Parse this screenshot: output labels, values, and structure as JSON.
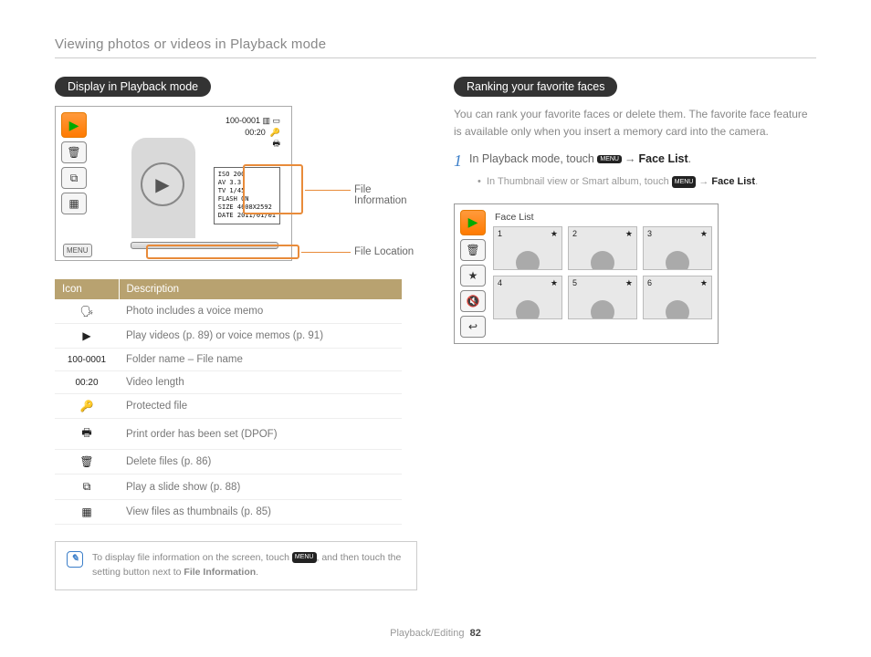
{
  "page_title": "Viewing photos or videos in Playback mode",
  "footer_section": "Playback/Editing",
  "footer_page": "82",
  "left": {
    "pill": "Display in Playback mode",
    "screen": {
      "file_id": "100-0001",
      "time": "00:20",
      "menu": "MENU",
      "info_lines": [
        "ISO 200",
        "AV 3.3",
        "TV 1/45",
        "FLASH ON",
        "SIZE 4608X2592",
        "DATE 2011/01/01"
      ]
    },
    "callouts": {
      "info": "File Information",
      "loc": "File Location"
    },
    "table_headers": {
      "icon": "Icon",
      "desc": "Description"
    },
    "rows": [
      {
        "icon": "🗣",
        "desc": "Photo includes a voice memo"
      },
      {
        "icon": "▶",
        "desc": "Play videos (p. 89) or voice memos (p. 91)"
      },
      {
        "icon": "100-0001",
        "desc": "Folder name – File name"
      },
      {
        "icon": "00:20",
        "desc": "Video length"
      },
      {
        "icon": "🔑",
        "desc": "Protected file"
      },
      {
        "icon": "🖶",
        "desc": "Print order has been set (DPOF)"
      },
      {
        "icon": "🗑",
        "desc": "Delete files (p. 86)"
      },
      {
        "icon": "⧉",
        "desc": "Play a slide show (p. 88)"
      },
      {
        "icon": "▦",
        "desc": "View files as thumbnails (p. 85)"
      }
    ],
    "note_pre": "To display file information on the screen, touch ",
    "note_menu": "MENU",
    "note_mid": ", and then touch the setting button next to ",
    "note_bold": "File Information",
    "note_post": "."
  },
  "right": {
    "pill": "Ranking your favorite faces",
    "intro": "You can rank your favorite faces or delete them. The favorite face feature is available only when you insert a memory card into the camera.",
    "step_num": "1",
    "step_pre": "In Playback mode, touch ",
    "step_menu": "MENU",
    "step_arrow": "→",
    "step_bold": "Face List",
    "step_post": ".",
    "sub_pre": "In Thumbnail view or Smart album, touch ",
    "sub_menu": "MENU",
    "sub_arrow": "→",
    "sub_bold": "Face List",
    "sub_post": ".",
    "face_label": "Face List",
    "face_nums": [
      "1",
      "2",
      "3",
      "4",
      "5",
      "6"
    ]
  }
}
